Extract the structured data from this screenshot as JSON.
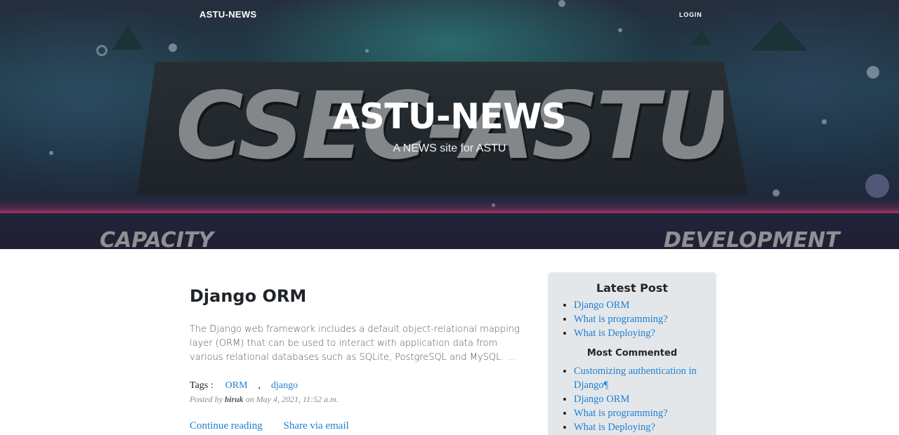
{
  "nav": {
    "brand": "ASTU-NEWS",
    "login": "LOGIN"
  },
  "hero": {
    "title": "ASTU-NEWS",
    "subtitle": "A NEWS site for ASTU",
    "image_text": "CSEC-ASTU",
    "image_text_left": "CAPACITY",
    "image_text_right": "DEVELOPMENT"
  },
  "post": {
    "title": "Django ORM",
    "excerpt": "The Django web framework includes a default object-relational mapping layer (ORM) that can be used to interact with application data from various relational databases such as SQLite, PostgreSQL and MySQL. ...",
    "tags_label": "Tags :",
    "tags": [
      "ORM",
      "django"
    ],
    "tag_separator": ",",
    "posted_by_prefix": "Posted by",
    "author": "biruk",
    "date_prefix": "on",
    "date": "May 4, 2021, 11:52 a.m.",
    "continue_label": "Continue reading",
    "share_label": "Share via email"
  },
  "sidebar": {
    "latest_heading": "Latest Post",
    "latest": [
      "Django ORM",
      "What is programming?",
      "What is Deploying?"
    ],
    "commented_heading": "Most Commented",
    "commented": [
      "Customizing authentication in Django¶",
      "Django ORM",
      "What is programming?",
      "What is Deploying?"
    ]
  },
  "colors": {
    "link": "#1d7fd0",
    "sidebar_bg": "#e4e7ea",
    "text": "#212529"
  }
}
